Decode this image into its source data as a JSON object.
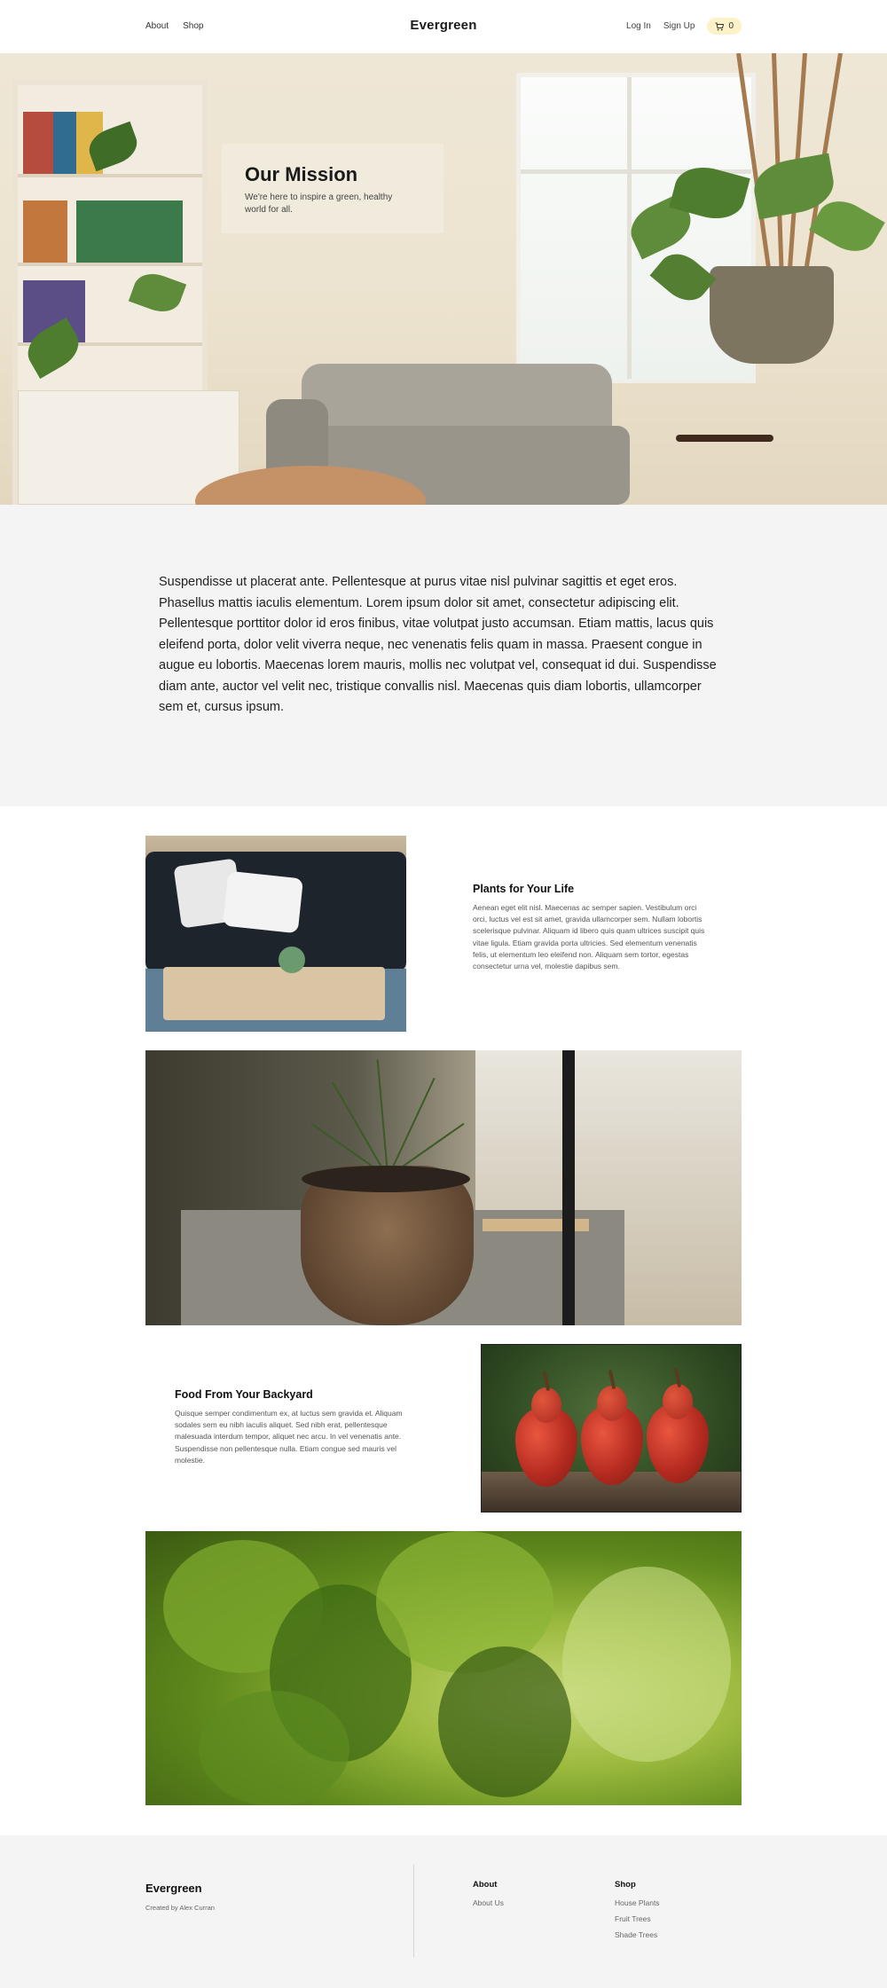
{
  "header": {
    "nav_left": [
      "About",
      "Shop"
    ],
    "brand": "Evergreen",
    "login": "Log In",
    "signup": "Sign Up",
    "cart_count": "0",
    "cart_icon": "cart-icon"
  },
  "hero": {
    "title": "Our Mission",
    "text": "We're here to inspire a green, healthy world for all."
  },
  "about": {
    "text": "Suspendisse ut placerat ante. Pellentesque at purus vitae nisl pulvinar sagittis et eget eros. Phasellus mattis iaculis elementum. Lorem ipsum dolor sit amet, consectetur adipiscing elit. Pellentesque porttitor dolor id eros finibus, vitae volutpat justo accumsan. Etiam mattis, lacus quis eleifend porta, dolor velit viverra neque, nec venenatis felis quam in massa. Praesent congue in augue eu lobortis. Maecenas lorem mauris, mollis nec volutpat vel, consequat id dui. Suspendisse diam ante, auctor vel velit nec, tristique convallis nisl. Maecenas quis diam lobortis, ullamcorper sem et, cursus ipsum."
  },
  "features": [
    {
      "title": "Plants for Your Life",
      "text": "Aenean eget elit nisl. Maecenas ac semper sapien. Vestibulum orci orci, luctus vel est sit amet, gravida ullamcorper sem. Nullam lobortis scelerisque pulvinar. Aliquam id libero quis quam ultrices suscipit quis vitae ligula. Etiam gravida porta ultricies. Sed elementum venenatis felis, ut elementum leo eleifend non. Aliquam sem tortor, egestas consectetur urna vel, molestie dapibus sem."
    },
    {
      "title": "Food From Your Backyard",
      "text": "Quisque semper condimentum ex, at luctus sem gravida et. Aliquam sodales sem eu nibh iaculis aliquet. Sed nibh erat, pellentesque malesuada interdum tempor, aliquet nec arcu. In vel venenatis ante. Suspendisse non pellentesque nulla. Etiam congue sed mauris vel molestie."
    }
  ],
  "footer": {
    "brand": "Evergreen",
    "credit": "Created by Alex Curran",
    "col_about": {
      "heading": "About",
      "links": [
        "About Us"
      ]
    },
    "col_shop": {
      "heading": "Shop",
      "links": [
        "House Plants",
        "Fruit Trees",
        "Shade Trees"
      ]
    }
  },
  "colors": {
    "cart_bg": "#fdf1c7",
    "section_bg": "#f4f4f4",
    "text": "#1a1a1a"
  }
}
